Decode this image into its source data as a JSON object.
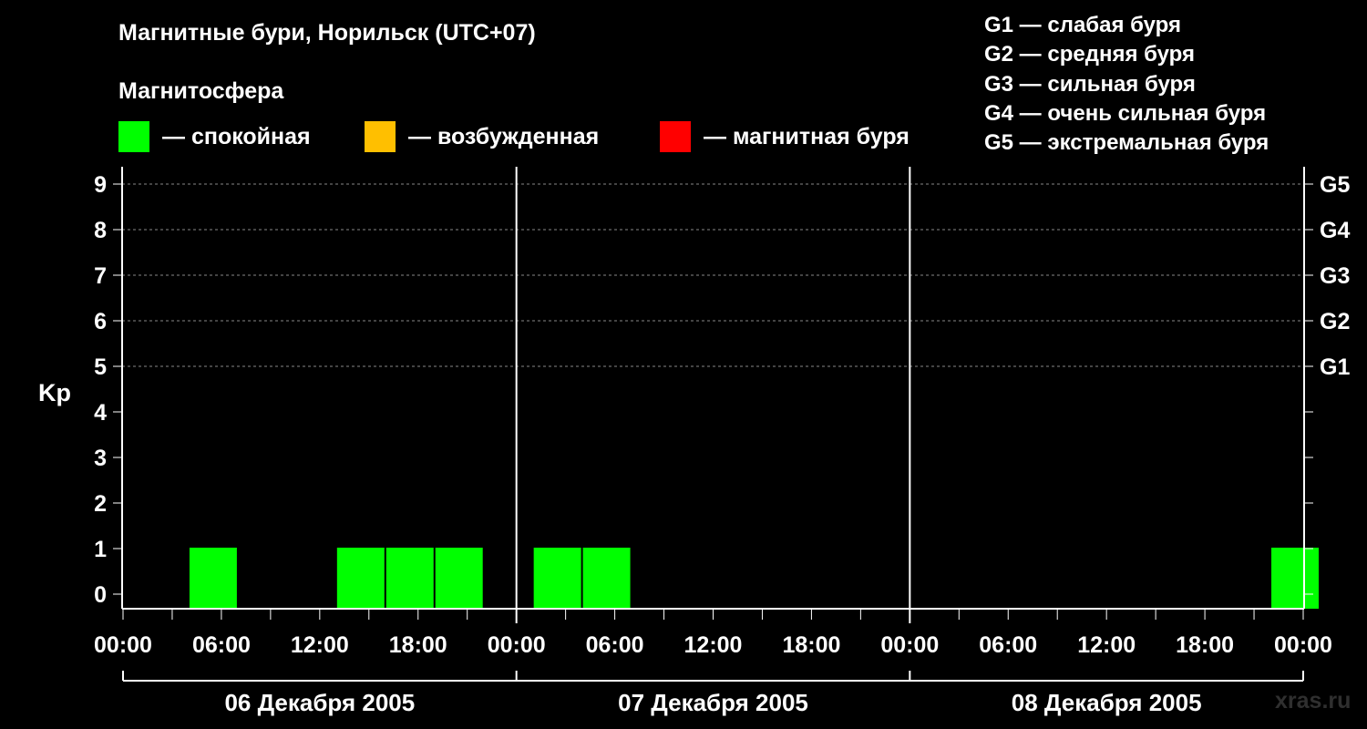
{
  "header": {
    "title": "Магнитные бури, Норильск (UTC+07)",
    "subtitle": "Магнитосфера"
  },
  "legend": {
    "items": [
      {
        "label": "— спокойная",
        "color": "#00ff00"
      },
      {
        "label": "— возбужденная",
        "color": "#ffbf00"
      },
      {
        "label": "— магнитная буря",
        "color": "#ff0000"
      }
    ]
  },
  "storm_scale": {
    "items": [
      "G1 — слабая буря",
      "G2 — средняя буря",
      "G3 — сильная буря",
      "G4 — очень сильная буря",
      "G5 — экстремальная буря"
    ]
  },
  "watermark": "xras.ru",
  "chart_data": {
    "type": "bar",
    "ylabel": "Kp",
    "ylim": [
      0,
      9
    ],
    "yticks": [
      "0",
      "1",
      "2",
      "3",
      "4",
      "5",
      "6",
      "7",
      "8",
      "9"
    ],
    "right_ticks": [
      {
        "kp": 5,
        "label": "G1"
      },
      {
        "kp": 6,
        "label": "G2"
      },
      {
        "kp": 7,
        "label": "G3"
      },
      {
        "kp": 8,
        "label": "G4"
      },
      {
        "kp": 9,
        "label": "G5"
      }
    ],
    "grid": "dashed horizontal lines at Kp 5-9",
    "x_tick_labels": [
      "00:00",
      "06:00",
      "12:00",
      "18:00",
      "00:00",
      "06:00",
      "12:00",
      "18:00",
      "00:00",
      "06:00",
      "12:00",
      "18:00",
      "00:00"
    ],
    "days": [
      "06 Декабря 2005",
      "07 Декабря 2005",
      "08 Декабря 2005"
    ],
    "interval_hours": 3,
    "bars": [
      {
        "day": 0,
        "start_hour": 4,
        "kp": 1,
        "color": "#00ff00"
      },
      {
        "day": 0,
        "start_hour": 13,
        "kp": 1,
        "color": "#00ff00"
      },
      {
        "day": 0,
        "start_hour": 16,
        "kp": 1,
        "color": "#00ff00"
      },
      {
        "day": 0,
        "start_hour": 19,
        "kp": 1,
        "color": "#00ff00"
      },
      {
        "day": 1,
        "start_hour": 1,
        "kp": 1,
        "color": "#00ff00"
      },
      {
        "day": 1,
        "start_hour": 4,
        "kp": 1,
        "color": "#00ff00"
      },
      {
        "day": 2,
        "start_hour": 22,
        "kp": 1,
        "color": "#00ff00"
      }
    ]
  }
}
